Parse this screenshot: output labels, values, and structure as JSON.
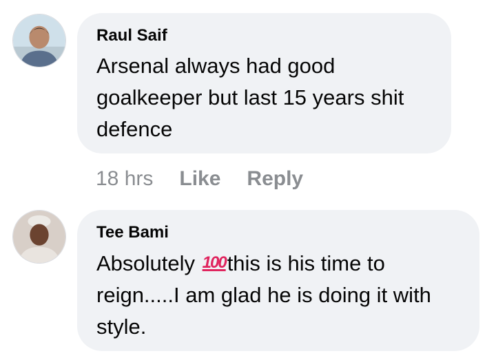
{
  "comments": [
    {
      "author": "Raul Saif",
      "text": "Arsenal always had good goalkeeper but last 15 years shit defence",
      "time": "18 hrs",
      "like_label": "Like",
      "reply_label": "Reply"
    },
    {
      "author": "Tee Bami",
      "text_before_emoji": "Absolutely ",
      "emoji": "100",
      "emoji_name": "hundred-points-emoji",
      "text_after_emoji": "this is his time to reign.....I am glad he is doing it with style."
    }
  ],
  "colors": {
    "bubble": "#f0f2f5",
    "text": "#050505",
    "meta": "#8a8d91"
  }
}
